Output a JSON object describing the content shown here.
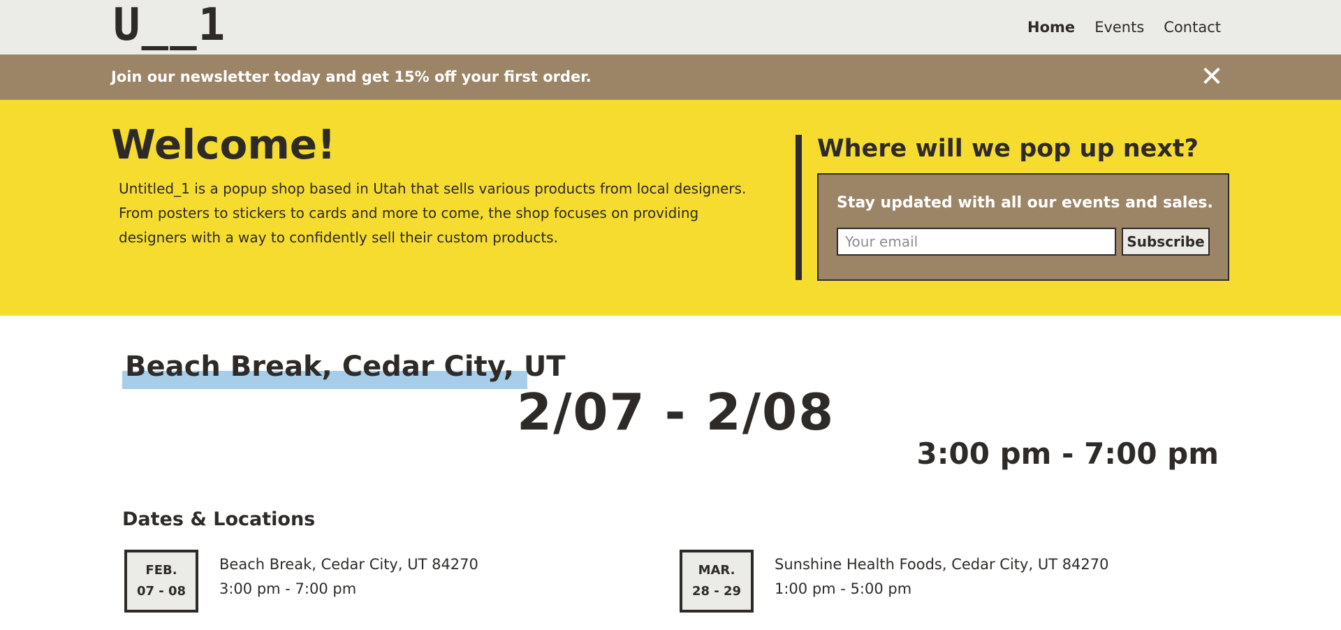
{
  "header": {
    "logo": "U__1",
    "nav": [
      {
        "label": "Home",
        "active": true
      },
      {
        "label": "Events",
        "active": false
      },
      {
        "label": "Contact",
        "active": false
      }
    ]
  },
  "banner": {
    "text": "Join our newsletter today and get 15% off your first order.",
    "close_icon": "close-icon"
  },
  "hero": {
    "title": "Welcome!",
    "body": "Untitled_1 is a popup shop based in Utah that sells various products from local designers. From posters to stickers to cards and more to come, the shop focuses on providing designers with a way to confidently sell their custom products.",
    "popup_heading": "Where will we pop up next?",
    "signup_text": "Stay updated with all our events and sales.",
    "email_placeholder": "Your email",
    "email_value": "",
    "subscribe_label": "Subscribe"
  },
  "featured_event": {
    "location": "Beach Break, Cedar City, UT",
    "dates": "2/07 - 2/08",
    "time": "3:00 pm - 7:00 pm"
  },
  "dates_locations": {
    "heading": "Dates & Locations",
    "items": [
      {
        "month": "FEB.",
        "days": "07 - 08",
        "location": "Beach Break, Cedar City, UT 84270",
        "time": "3:00 pm - 7:00 pm"
      },
      {
        "month": "MAR.",
        "days": "28 - 29",
        "location": "Sunshine Health Foods, Cedar City, UT 84270",
        "time": "1:00 pm - 5:00 pm"
      }
    ]
  },
  "colors": {
    "header_bg": "#ebebe7",
    "banner_bg": "#9b8566",
    "hero_bg": "#f5dc2f",
    "highlight": "#a6cde9",
    "text": "#2e2a27"
  }
}
